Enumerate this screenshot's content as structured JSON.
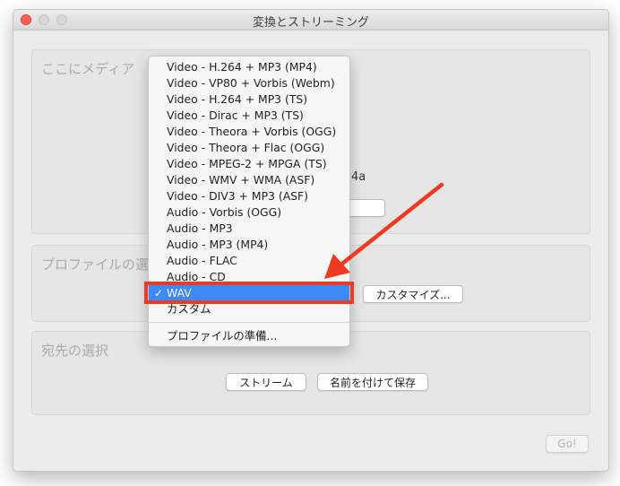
{
  "window": {
    "title": "変換とストリーミング"
  },
  "sections": {
    "media": {
      "title": "ここにメディア",
      "partial_text": "4a"
    },
    "profile": {
      "title": "プロファイルの選",
      "customize_label": "カスタマイズ..."
    },
    "destination": {
      "title": "宛先の選択",
      "stream_label": "ストリーム",
      "save_label": "名前を付けて保存"
    }
  },
  "go_label": "Go!",
  "menu": {
    "items": [
      "Video - H.264 + MP3 (MP4)",
      "Video - VP80 + Vorbis (Webm)",
      "Video - H.264 + MP3 (TS)",
      "Video - Dirac + MP3 (TS)",
      "Video - Theora + Vorbis (OGG)",
      "Video - Theora + Flac (OGG)",
      "Video - MPEG-2 + MPGA (TS)",
      "Video - WMV + WMA (ASF)",
      "Video - DIV3 + MP3 (ASF)",
      "Audio - Vorbis (OGG)",
      "Audio - MP3",
      "Audio - MP3 (MP4)",
      "Audio - FLAC",
      "Audio - CD"
    ],
    "selected": "WAV",
    "check": "✓",
    "custom": "カスタム",
    "prepare": "プロファイルの準備..."
  },
  "colors": {
    "selection": "#3d89f6",
    "highlight": "#f03a1f"
  }
}
